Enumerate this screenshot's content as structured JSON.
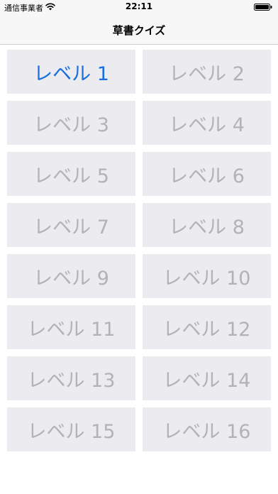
{
  "status_bar": {
    "carrier": "通信事業者",
    "time": "22:11"
  },
  "nav": {
    "title": "草書クイズ"
  },
  "levels": [
    {
      "label": "レベル 1",
      "active": true
    },
    {
      "label": "レベル 3",
      "active": false
    },
    {
      "label": "レベル 5",
      "active": false
    },
    {
      "label": "レベル 7",
      "active": false
    },
    {
      "label": "レベル 9",
      "active": false
    },
    {
      "label": "レベル 11",
      "active": false
    },
    {
      "label": "レベル 13",
      "active": false
    },
    {
      "label": "レベル 15",
      "active": false
    },
    {
      "label": "レベル 2",
      "active": false
    },
    {
      "label": "レベル 4",
      "active": false
    },
    {
      "label": "レベル 6",
      "active": false
    },
    {
      "label": "レベル 8",
      "active": false
    },
    {
      "label": "レベル 10",
      "active": false
    },
    {
      "label": "レベル 12",
      "active": false
    },
    {
      "label": "レベル 14",
      "active": false
    },
    {
      "label": "レベル 16",
      "active": false
    }
  ],
  "colors": {
    "active_text": "#1a6fe0",
    "inactive_text": "#b3b3b6",
    "button_bg": "#ebebf0"
  },
  "icons": {
    "wifi": "wifi-icon",
    "battery": "battery-icon"
  }
}
